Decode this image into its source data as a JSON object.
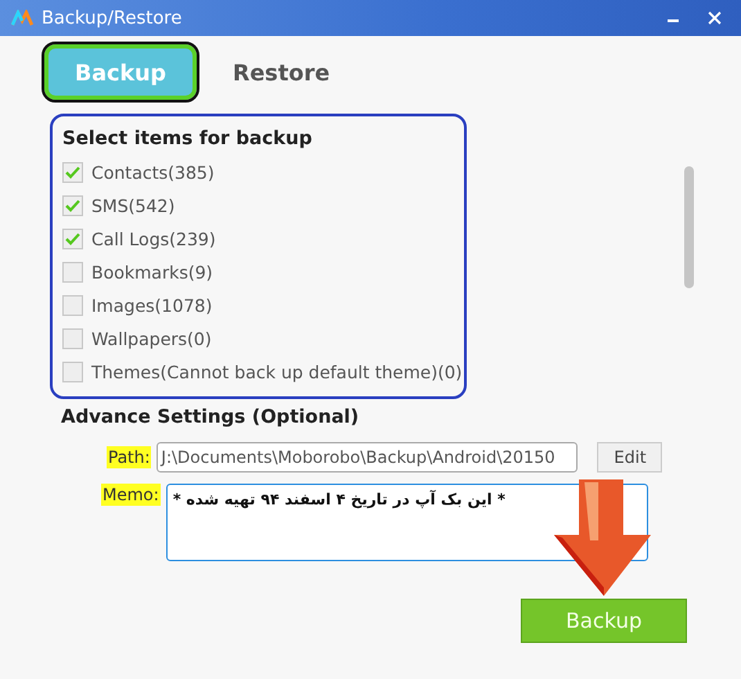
{
  "window": {
    "title": "Backup/Restore"
  },
  "tabs": [
    {
      "label": "Backup",
      "selected": true
    },
    {
      "label": "Restore",
      "selected": false
    }
  ],
  "items_panel": {
    "heading": "Select items for backup",
    "items": [
      {
        "label": "Contacts(385)",
        "checked": true
      },
      {
        "label": "SMS(542)",
        "checked": true
      },
      {
        "label": "Call Logs(239)",
        "checked": true
      },
      {
        "label": "Bookmarks(9)",
        "checked": false
      },
      {
        "label": "Images(1078)",
        "checked": false
      },
      {
        "label": "Wallpapers(0)",
        "checked": false
      },
      {
        "label": "Themes(Cannot back up default theme)(0)",
        "checked": false
      }
    ]
  },
  "advanced": {
    "heading": "Advance Settings (Optional)",
    "path_label": "Path:",
    "path_value": "J:\\Documents\\Moborobo\\Backup\\Android\\20150",
    "edit_button": "Edit",
    "memo_label": "Memo:",
    "memo_value": "* این بک آپ در تاریخ ۴ اسفند ۹۴ تهیه شده *"
  },
  "backup_button": "Backup"
}
